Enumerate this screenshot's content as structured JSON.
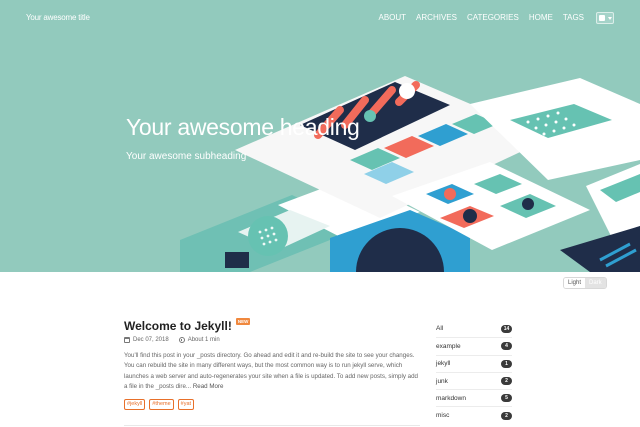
{
  "site": {
    "title": "Your awesome title"
  },
  "nav": {
    "items": [
      "ABOUT",
      "ARCHIVES",
      "CATEGORIES",
      "HOME",
      "TAGS"
    ]
  },
  "language_button": {
    "icon": "flag-icon"
  },
  "hero": {
    "heading": "Your awesome heading",
    "subheading": "Your awesome subheading",
    "background": "#92cabd"
  },
  "theme_switch": {
    "light": "Light",
    "dark": "Dark",
    "active": "Light"
  },
  "post": {
    "title": "Welcome to Jekyll!",
    "badge": "NEW",
    "date": "Dec 07, 2018",
    "read_time": "About 1 min",
    "excerpt": "You'll find this post in your _posts directory. Go ahead and edit it and re-build the site to see your changes. You can rebuild the site in many different ways, but the most common way is to run jekyll serve, which launches a web server and auto-regenerates your site when a file is updated. To add new posts, simply add a file in the _posts dire...",
    "read_more": "Read More",
    "tags": [
      "#jekyll",
      "#theme",
      "#yat"
    ]
  },
  "categories": [
    {
      "label": "All",
      "count": "14"
    },
    {
      "label": "example",
      "count": "4"
    },
    {
      "label": "jekyll",
      "count": "1"
    },
    {
      "label": "junk",
      "count": "2"
    },
    {
      "label": "markdown",
      "count": "5"
    },
    {
      "label": "misc",
      "count": "2"
    }
  ],
  "colors": {
    "accent": "#e8702a",
    "hero": "#92cabd",
    "badge": "#3a3a3a"
  }
}
